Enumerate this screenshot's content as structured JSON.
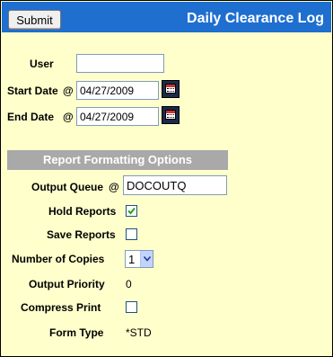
{
  "header": {
    "submit_label": "Submit",
    "title": "Daily Clearance Log",
    "color": "#1e6fd0"
  },
  "form": {
    "user_label": "User",
    "user_value": "",
    "start_date_label": "Start Date",
    "start_date_at": "@",
    "start_date_value": "04/27/2009",
    "end_date_label": "End Date",
    "end_date_at": "@",
    "end_date_value": "04/27/2009",
    "calendar_icon": "calendar-icon"
  },
  "report_options": {
    "section_title": "Report Formatting Options",
    "output_queue_label": "Output Queue",
    "output_queue_at": "@",
    "output_queue_value": "DOCOUTQ",
    "hold_reports_label": "Hold Reports",
    "hold_reports_checked": true,
    "save_reports_label": "Save Reports",
    "save_reports_checked": false,
    "copies_label": "Number of Copies",
    "copies_value": "1",
    "priority_label": "Output Priority",
    "priority_value": "0",
    "compress_label": "Compress Print",
    "compress_checked": false,
    "form_type_label": "Form Type",
    "form_type_value": "*STD"
  }
}
